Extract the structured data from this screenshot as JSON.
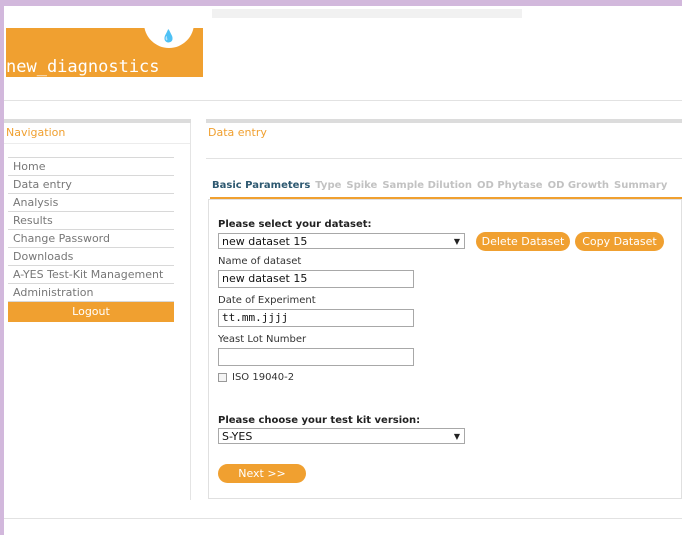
{
  "logo": {
    "text": "new_diagnostics",
    "drop_icon": "drop-icon"
  },
  "navigation": {
    "title": "Navigation",
    "items": [
      {
        "label": "Home"
      },
      {
        "label": "Data entry"
      },
      {
        "label": "Analysis"
      },
      {
        "label": "Results"
      },
      {
        "label": "Change Password"
      },
      {
        "label": "Downloads"
      },
      {
        "label": "A-YES Test-Kit Management"
      },
      {
        "label": "Administration"
      }
    ],
    "logout_label": "Logout"
  },
  "main": {
    "title": "Data entry",
    "tabs": [
      {
        "label": "Basic Parameters",
        "active": true
      },
      {
        "label": "Type",
        "active": false
      },
      {
        "label": "Spike",
        "active": false
      },
      {
        "label": "Sample Dilution",
        "active": false
      },
      {
        "label": "OD Phytase",
        "active": false
      },
      {
        "label": "OD Growth",
        "active": false
      },
      {
        "label": "Summary",
        "active": false
      }
    ]
  },
  "form": {
    "dataset_select_label": "Please select your dataset:",
    "dataset_selected": "new dataset 15",
    "delete_button": "Delete Dataset",
    "copy_button": "Copy Dataset",
    "name_label": "Name of dataset",
    "name_value": "new dataset 15",
    "date_label": "Date of Experiment",
    "date_value": "tt.mm.jjjj",
    "yeast_label": "Yeast Lot Number",
    "yeast_value": "",
    "iso_label": "ISO 19040-2",
    "iso_checked": false,
    "kit_label": "Please choose your test kit version:",
    "kit_selected": "S-YES",
    "next_button": "Next >>"
  },
  "colors": {
    "accent": "#f0a030",
    "active_tab": "#2d5870",
    "frame": "#d2b8dc"
  }
}
